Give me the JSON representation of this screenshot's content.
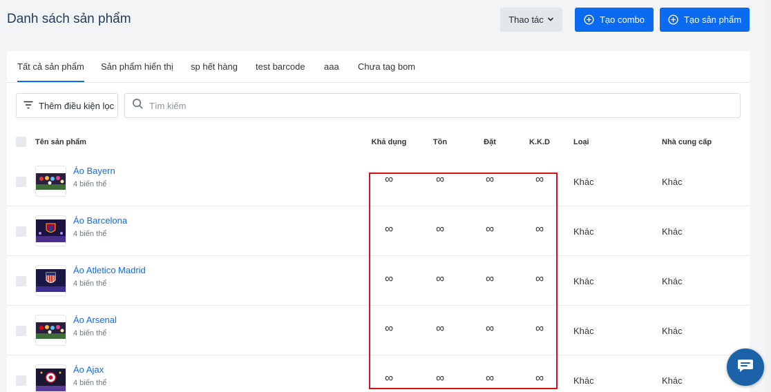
{
  "page": {
    "title": "Danh sách sản phẩm",
    "actions_label": "Thao tác",
    "create_combo_label": "Tạo combo",
    "create_product_label": "Tạo sản phẩm"
  },
  "tabs": [
    {
      "label": "Tất cả sản phẩm",
      "active": true
    },
    {
      "label": "Sản phẩm hiển thị"
    },
    {
      "label": "sp hết hàng"
    },
    {
      "label": "test barcode"
    },
    {
      "label": "aaa"
    },
    {
      "label": "Chưa tag bom"
    }
  ],
  "filter": {
    "add_filter_label": "Thêm điều kiện lọc",
    "search_placeholder": "Tìm kiếm",
    "search_value": ""
  },
  "table": {
    "columns": {
      "name": "Tên sản phẩm",
      "available": "Khả dụng",
      "stock": "Tồn",
      "ordered": "Đặt",
      "kkd": "K.K.D",
      "type": "Loại",
      "supplier": "Nhà cung cấp"
    },
    "rows": [
      {
        "name": "Áo Bayern",
        "variants": "4 biến thể",
        "available": "∞",
        "stock": "∞",
        "ordered": "∞",
        "kkd": "∞",
        "type": "Khác",
        "supplier": "Khác",
        "thumb": "bayern-thumbnail"
      },
      {
        "name": "Áo Barcelona",
        "variants": "4 biến thể",
        "available": "∞",
        "stock": "∞",
        "ordered": "∞",
        "kkd": "∞",
        "type": "Khác",
        "supplier": "Khác",
        "thumb": "barcelona-thumbnail"
      },
      {
        "name": "Áo Atletico Madrid",
        "variants": "4 biến thể",
        "available": "∞",
        "stock": "∞",
        "ordered": "∞",
        "kkd": "∞",
        "type": "Khác",
        "supplier": "Khác",
        "thumb": "atletico-thumbnail"
      },
      {
        "name": "Áo Arsenal",
        "variants": "4 biến thể",
        "available": "∞",
        "stock": "∞",
        "ordered": "∞",
        "kkd": "∞",
        "type": "Khác",
        "supplier": "Khác",
        "thumb": "arsenal-thumbnail"
      },
      {
        "name": "Áo Ajax",
        "variants": "4 biến thể",
        "available": "∞",
        "stock": "∞",
        "ordered": "∞",
        "kkd": "∞",
        "type": "Khác",
        "supplier": "Khác",
        "thumb": "ajax-thumbnail"
      }
    ]
  },
  "colors": {
    "primary": "#0a6bf0",
    "title": "#1f3a5c",
    "highlight": "#d90f16",
    "chat": "#1b62a8"
  },
  "icons": [
    "chevron-down-icon",
    "plus-circle-icon",
    "filter-icon",
    "search-icon",
    "chat-icon"
  ]
}
